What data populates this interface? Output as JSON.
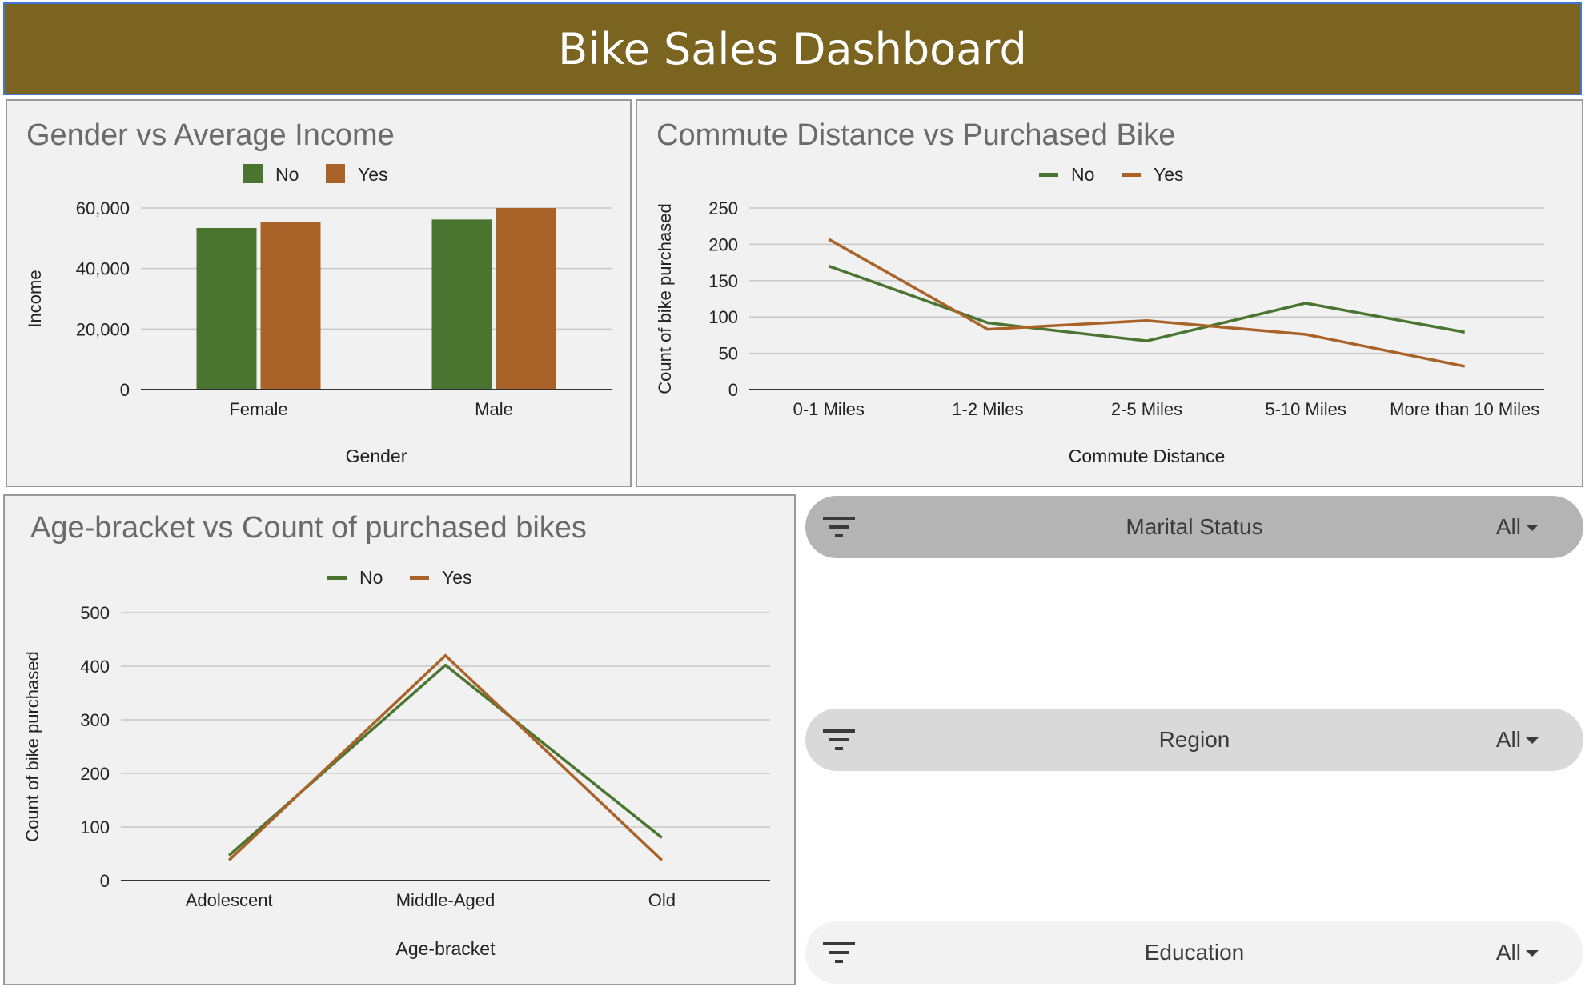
{
  "header": {
    "title": "Bike Sales Dashboard"
  },
  "colors": {
    "header_bg": "#7a6420",
    "no": "#4a7530",
    "yes": "#a96328",
    "grid": "#c8c8c8",
    "title_text": "#6a6a6a"
  },
  "chart_data": [
    {
      "type": "bar",
      "title": "Gender vs Average Income",
      "xlabel": "Gender",
      "ylabel": "Income",
      "categories": [
        "Female",
        "Male"
      ],
      "series": [
        {
          "name": "No",
          "values": [
            53400,
            56200
          ]
        },
        {
          "name": "Yes",
          "values": [
            55300,
            60000
          ]
        }
      ],
      "ylim": [
        0,
        60000
      ],
      "yticks": [
        0,
        20000,
        40000,
        60000
      ],
      "ytick_labels": [
        "0",
        "20,000",
        "40,000",
        "60,000"
      ],
      "legend": "top",
      "grid": true
    },
    {
      "type": "line",
      "title": "Commute Distance vs Purchased Bike",
      "xlabel": "Commute Distance",
      "ylabel": "Count of bike purchased",
      "categories": [
        "0-1 Miles",
        "1-2 Miles",
        "2-5 Miles",
        "5-10 Miles",
        "More than 10 Miles"
      ],
      "series": [
        {
          "name": "No",
          "values": [
            170,
            92,
            67,
            119,
            79
          ]
        },
        {
          "name": "Yes",
          "values": [
            207,
            83,
            95,
            76,
            32
          ]
        }
      ],
      "ylim": [
        0,
        250
      ],
      "yticks": [
        0,
        50,
        100,
        150,
        200,
        250
      ],
      "ytick_labels": [
        "0",
        "50",
        "100",
        "150",
        "200",
        "250"
      ],
      "legend": "top",
      "grid": true
    },
    {
      "type": "line",
      "title": "Age-bracket vs Count of purchased bikes",
      "xlabel": "Age-bracket",
      "ylabel": "Count of bike purchased",
      "categories": [
        "Adolescent",
        "Middle-Aged",
        "Old"
      ],
      "series": [
        {
          "name": "No",
          "values": [
            47,
            402,
            80
          ]
        },
        {
          "name": "Yes",
          "values": [
            38,
            420,
            38
          ]
        }
      ],
      "ylim": [
        0,
        500
      ],
      "yticks": [
        0,
        100,
        200,
        300,
        400,
        500
      ],
      "ytick_labels": [
        "0",
        "100",
        "200",
        "300",
        "400",
        "500"
      ],
      "legend": "top",
      "grid": true
    }
  ],
  "filters": [
    {
      "label": "Marital Status",
      "value": "All",
      "bg": "#b4b4b4"
    },
    {
      "label": "Region",
      "value": "All",
      "bg": "#d9d9d9"
    },
    {
      "label": "Education",
      "value": "All",
      "bg": "#f2f2f2"
    }
  ]
}
